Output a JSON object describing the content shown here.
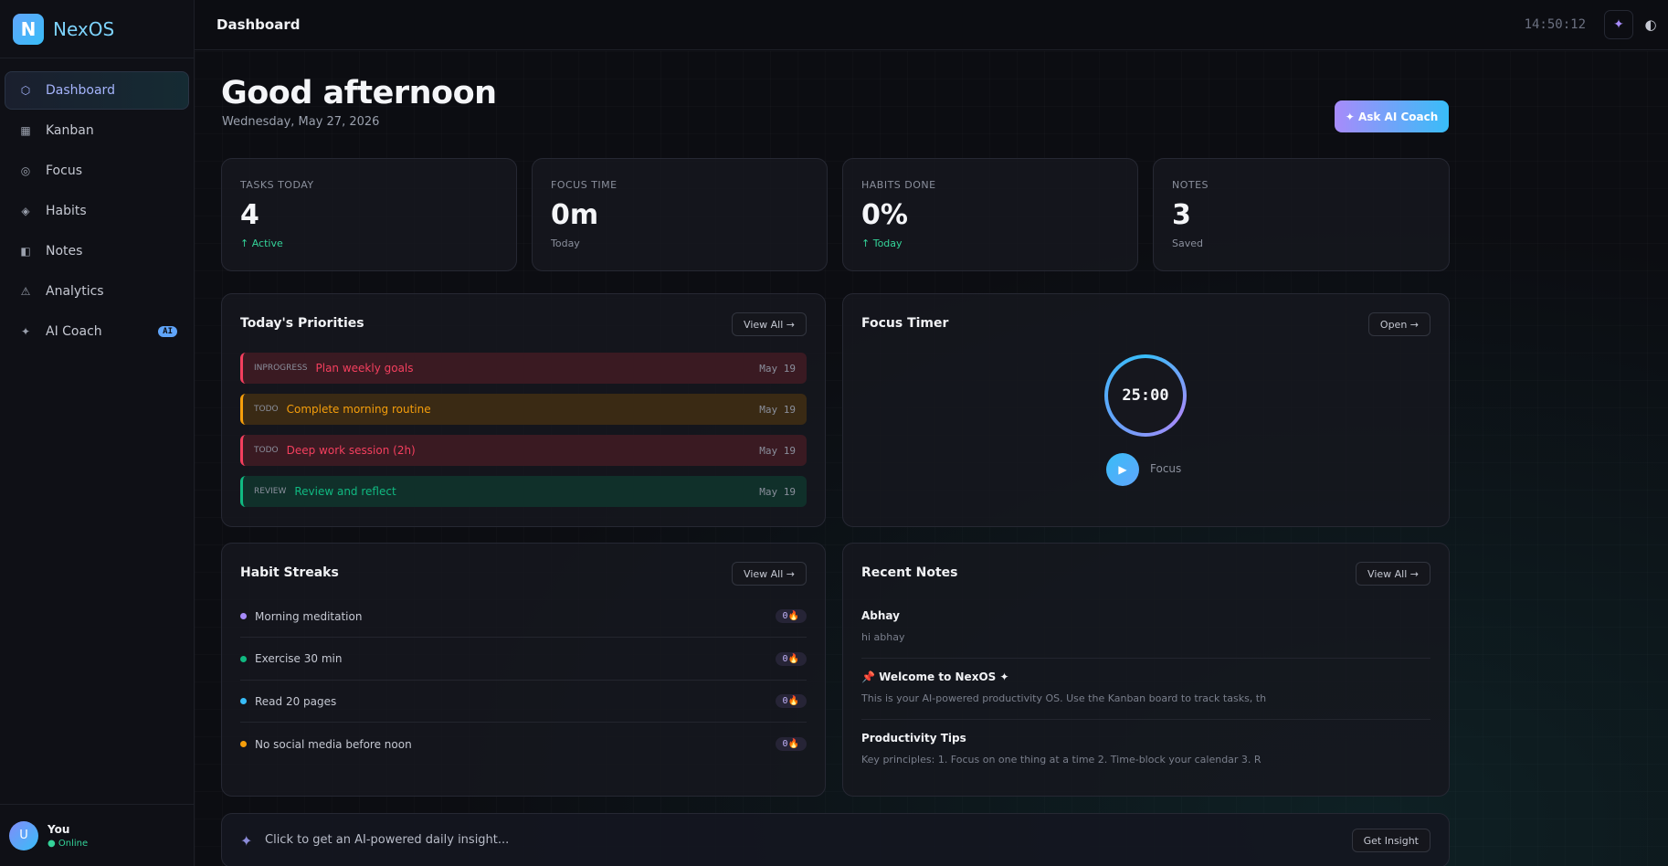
{
  "brand": {
    "logo_letter": "N",
    "name": "NexOS"
  },
  "nav": [
    {
      "icon": "⬡",
      "label": "Dashboard",
      "active": true,
      "icon_name": "hexagon-icon"
    },
    {
      "icon": "▦",
      "label": "Kanban",
      "icon_name": "kanban-icon"
    },
    {
      "icon": "◎",
      "label": "Focus",
      "icon_name": "focus-icon"
    },
    {
      "icon": "◈",
      "label": "Habits",
      "icon_name": "habits-icon"
    },
    {
      "icon": "◧",
      "label": "Notes",
      "icon_name": "notes-icon"
    },
    {
      "icon": "⚠",
      "label": "Analytics",
      "icon_name": "analytics-icon"
    },
    {
      "icon": "✦",
      "label": "AI Coach",
      "badge": "AI",
      "icon_name": "sparkle-icon"
    }
  ],
  "user": {
    "initial": "U",
    "name": "You",
    "status": "● Online"
  },
  "topbar": {
    "title": "Dashboard",
    "clock": "14:50:12",
    "ai_icon": "✦",
    "theme_icon": "◐"
  },
  "header": {
    "greeting": "Good afternoon",
    "date": "Wednesday, May 27, 2026",
    "coach_button": "✦ Ask AI Coach"
  },
  "stats": [
    {
      "label": "TASKS TODAY",
      "value": "4",
      "sub": "↑ Active",
      "up": true
    },
    {
      "label": "FOCUS TIME",
      "value": "0m",
      "sub": "Today",
      "up": false
    },
    {
      "label": "HABITS DONE",
      "value": "0%",
      "sub": "↑ Today",
      "up": true
    },
    {
      "label": "NOTES",
      "value": "3",
      "sub": "Saved",
      "up": false
    }
  ],
  "priorities": {
    "title": "Today's Priorities",
    "button": "View All →",
    "items": [
      {
        "status": "INPROGRESS",
        "name": "Plan weekly goals",
        "date": "May 19",
        "color": "#f43f5e",
        "bg": "#3a1a22"
      },
      {
        "status": "TODO",
        "name": "Complete morning routine",
        "date": "May 19",
        "color": "#f59e0b",
        "bg": "#3a2a14"
      },
      {
        "status": "TODO",
        "name": "Deep work session (2h)",
        "date": "May 19",
        "color": "#f43f5e",
        "bg": "#3a1a22"
      },
      {
        "status": "REVIEW",
        "name": "Review and reflect",
        "date": "May 19",
        "color": "#10b981",
        "bg": "#10302a"
      }
    ]
  },
  "timer": {
    "title": "Focus Timer",
    "button": "Open →",
    "time": "25:00",
    "play_icon": "▶",
    "mode": "Focus"
  },
  "habits": {
    "title": "Habit Streaks",
    "button": "View All →",
    "items": [
      {
        "name": "Morning meditation",
        "streak": "0🔥",
        "color": "#a78bfa"
      },
      {
        "name": "Exercise 30 min",
        "streak": "0🔥",
        "color": "#10b981"
      },
      {
        "name": "Read 20 pages",
        "streak": "0🔥",
        "color": "#38bdf8"
      },
      {
        "name": "No social media before noon",
        "streak": "0🔥",
        "color": "#f59e0b"
      }
    ]
  },
  "notes": {
    "title": "Recent Notes",
    "button": "View All →",
    "items": [
      {
        "title": "Abhay",
        "body": "hi abhay"
      },
      {
        "title": "📌 Welcome to NexOS ✦",
        "body": "This is your AI-powered productivity OS. Use the Kanban board to track tasks, th"
      },
      {
        "title": "Productivity Tips",
        "body": "Key principles: 1. Focus on one thing at a time 2. Time-block your calendar 3. R"
      }
    ]
  },
  "insight": {
    "icon": "✦",
    "text": "Click to get an AI-powered daily insight...",
    "button": "Get Insight"
  }
}
